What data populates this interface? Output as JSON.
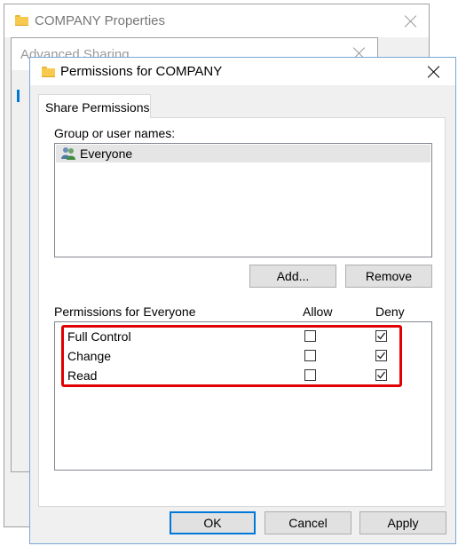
{
  "back_window": {
    "title": "COMPANY Properties"
  },
  "middle_window": {
    "title": "Advanced Sharing"
  },
  "dialog": {
    "title": "Permissions for COMPANY",
    "tab_label": "Share Permissions",
    "group_label": "Group or user names:",
    "users": [
      {
        "name": "Everyone",
        "icon": "users-icon",
        "selected": true
      }
    ],
    "add_label": "Add...",
    "remove_label": "Remove",
    "perm_header": "Permissions for Everyone",
    "allow_header": "Allow",
    "deny_header": "Deny",
    "permissions": [
      {
        "name": "Full Control",
        "allow": false,
        "deny": true
      },
      {
        "name": "Change",
        "allow": false,
        "deny": true
      },
      {
        "name": "Read",
        "allow": false,
        "deny": true
      }
    ],
    "ok_label": "OK",
    "cancel_label": "Cancel",
    "apply_label": "Apply"
  },
  "colors": {
    "highlight": "#e00000",
    "accent": "#0078d7",
    "selection": "#e5e5e5"
  }
}
